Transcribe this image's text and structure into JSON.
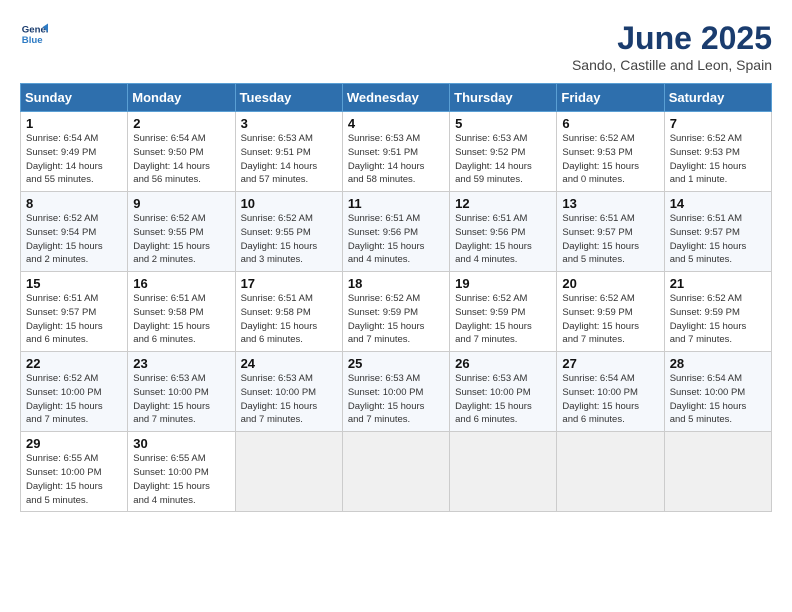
{
  "logo": {
    "line1": "General",
    "line2": "Blue"
  },
  "title": "June 2025",
  "subtitle": "Sando, Castille and Leon, Spain",
  "days_of_week": [
    "Sunday",
    "Monday",
    "Tuesday",
    "Wednesday",
    "Thursday",
    "Friday",
    "Saturday"
  ],
  "weeks": [
    [
      {
        "day": 1,
        "info": "Sunrise: 6:54 AM\nSunset: 9:49 PM\nDaylight: 14 hours\nand 55 minutes."
      },
      {
        "day": 2,
        "info": "Sunrise: 6:54 AM\nSunset: 9:50 PM\nDaylight: 14 hours\nand 56 minutes."
      },
      {
        "day": 3,
        "info": "Sunrise: 6:53 AM\nSunset: 9:51 PM\nDaylight: 14 hours\nand 57 minutes."
      },
      {
        "day": 4,
        "info": "Sunrise: 6:53 AM\nSunset: 9:51 PM\nDaylight: 14 hours\nand 58 minutes."
      },
      {
        "day": 5,
        "info": "Sunrise: 6:53 AM\nSunset: 9:52 PM\nDaylight: 14 hours\nand 59 minutes."
      },
      {
        "day": 6,
        "info": "Sunrise: 6:52 AM\nSunset: 9:53 PM\nDaylight: 15 hours\nand 0 minutes."
      },
      {
        "day": 7,
        "info": "Sunrise: 6:52 AM\nSunset: 9:53 PM\nDaylight: 15 hours\nand 1 minute."
      }
    ],
    [
      {
        "day": 8,
        "info": "Sunrise: 6:52 AM\nSunset: 9:54 PM\nDaylight: 15 hours\nand 2 minutes."
      },
      {
        "day": 9,
        "info": "Sunrise: 6:52 AM\nSunset: 9:55 PM\nDaylight: 15 hours\nand 2 minutes."
      },
      {
        "day": 10,
        "info": "Sunrise: 6:52 AM\nSunset: 9:55 PM\nDaylight: 15 hours\nand 3 minutes."
      },
      {
        "day": 11,
        "info": "Sunrise: 6:51 AM\nSunset: 9:56 PM\nDaylight: 15 hours\nand 4 minutes."
      },
      {
        "day": 12,
        "info": "Sunrise: 6:51 AM\nSunset: 9:56 PM\nDaylight: 15 hours\nand 4 minutes."
      },
      {
        "day": 13,
        "info": "Sunrise: 6:51 AM\nSunset: 9:57 PM\nDaylight: 15 hours\nand 5 minutes."
      },
      {
        "day": 14,
        "info": "Sunrise: 6:51 AM\nSunset: 9:57 PM\nDaylight: 15 hours\nand 5 minutes."
      }
    ],
    [
      {
        "day": 15,
        "info": "Sunrise: 6:51 AM\nSunset: 9:57 PM\nDaylight: 15 hours\nand 6 minutes."
      },
      {
        "day": 16,
        "info": "Sunrise: 6:51 AM\nSunset: 9:58 PM\nDaylight: 15 hours\nand 6 minutes."
      },
      {
        "day": 17,
        "info": "Sunrise: 6:51 AM\nSunset: 9:58 PM\nDaylight: 15 hours\nand 6 minutes."
      },
      {
        "day": 18,
        "info": "Sunrise: 6:52 AM\nSunset: 9:59 PM\nDaylight: 15 hours\nand 7 minutes."
      },
      {
        "day": 19,
        "info": "Sunrise: 6:52 AM\nSunset: 9:59 PM\nDaylight: 15 hours\nand 7 minutes."
      },
      {
        "day": 20,
        "info": "Sunrise: 6:52 AM\nSunset: 9:59 PM\nDaylight: 15 hours\nand 7 minutes."
      },
      {
        "day": 21,
        "info": "Sunrise: 6:52 AM\nSunset: 9:59 PM\nDaylight: 15 hours\nand 7 minutes."
      }
    ],
    [
      {
        "day": 22,
        "info": "Sunrise: 6:52 AM\nSunset: 10:00 PM\nDaylight: 15 hours\nand 7 minutes."
      },
      {
        "day": 23,
        "info": "Sunrise: 6:53 AM\nSunset: 10:00 PM\nDaylight: 15 hours\nand 7 minutes."
      },
      {
        "day": 24,
        "info": "Sunrise: 6:53 AM\nSunset: 10:00 PM\nDaylight: 15 hours\nand 7 minutes."
      },
      {
        "day": 25,
        "info": "Sunrise: 6:53 AM\nSunset: 10:00 PM\nDaylight: 15 hours\nand 7 minutes."
      },
      {
        "day": 26,
        "info": "Sunrise: 6:53 AM\nSunset: 10:00 PM\nDaylight: 15 hours\nand 6 minutes."
      },
      {
        "day": 27,
        "info": "Sunrise: 6:54 AM\nSunset: 10:00 PM\nDaylight: 15 hours\nand 6 minutes."
      },
      {
        "day": 28,
        "info": "Sunrise: 6:54 AM\nSunset: 10:00 PM\nDaylight: 15 hours\nand 5 minutes."
      }
    ],
    [
      {
        "day": 29,
        "info": "Sunrise: 6:55 AM\nSunset: 10:00 PM\nDaylight: 15 hours\nand 5 minutes."
      },
      {
        "day": 30,
        "info": "Sunrise: 6:55 AM\nSunset: 10:00 PM\nDaylight: 15 hours\nand 4 minutes."
      },
      null,
      null,
      null,
      null,
      null
    ]
  ]
}
